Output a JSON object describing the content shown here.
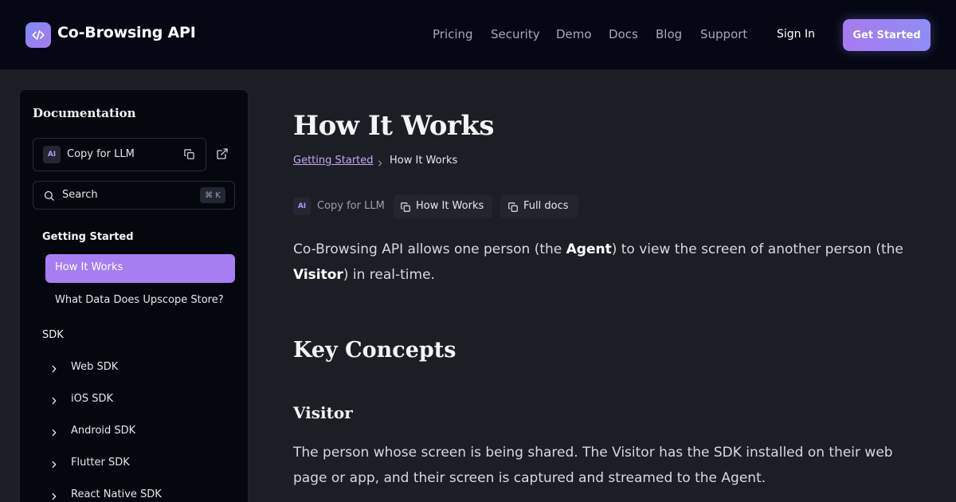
{
  "header": {
    "brand": "Co-Browsing API",
    "nav": [
      "Pricing",
      "Security",
      "Demo",
      "Docs",
      "Blog",
      "Support"
    ],
    "sign_in": "Sign In",
    "cta": "Get Started"
  },
  "sidebar": {
    "title": "Documentation",
    "copy_badge": "AI",
    "copy_label": "Copy for LLM",
    "search_label": "Search",
    "search_shortcut": "⌘ K",
    "section_getting_started": "Getting Started",
    "getting_started_items": [
      "How It Works",
      "What Data Does Upscope Store?"
    ],
    "section_sdk": "SDK",
    "sdk_items": [
      "Web SDK",
      "iOS SDK",
      "Android SDK",
      "Flutter SDK",
      "React Native SDK"
    ]
  },
  "main": {
    "title": "How It Works",
    "breadcrumb": {
      "parent": "Getting Started",
      "current": "How It Works"
    },
    "actions": {
      "badge": "AI",
      "copy_llm": "Copy for LLM",
      "copy_page": "How It Works",
      "full_docs": "Full docs"
    },
    "intro": {
      "part1": "Co-Browsing API allows one person (the ",
      "agent": "Agent",
      "part2": ") to view the screen of another person (the ",
      "visitor": "Visitor",
      "part3": ") in real-time."
    },
    "key_concepts_heading": "Key Concepts",
    "visitor_heading": "Visitor",
    "visitor_text": "The person whose screen is being shared. The Visitor has the SDK installed on their web page or app, and their screen is captured and streamed to the Agent."
  },
  "colors": {
    "accent": "#a77ef2",
    "link": "#c4a6f7",
    "header_bg": "#050814",
    "page_bg": "#1c1e25"
  },
  "icons": [
    "code-icon",
    "copy-icon",
    "external-link-icon",
    "search-icon",
    "chevron-right-icon"
  ]
}
